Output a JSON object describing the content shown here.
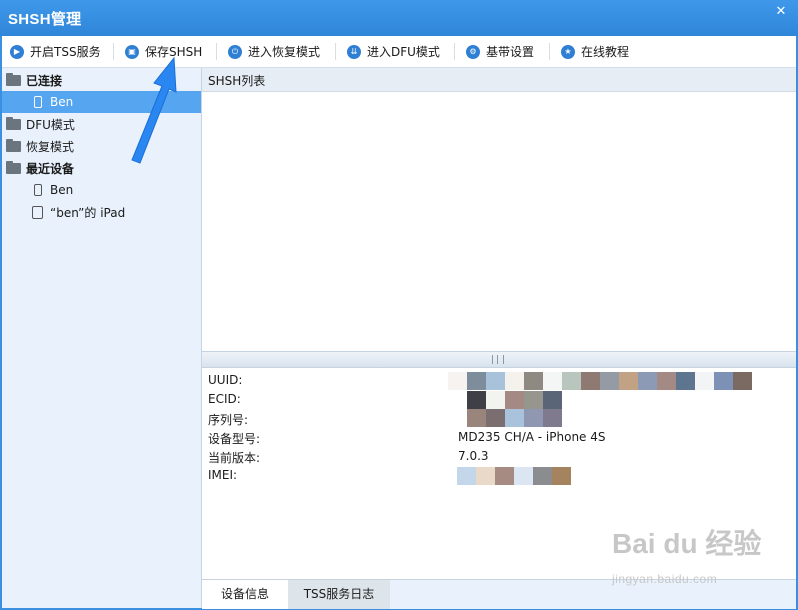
{
  "window": {
    "title": "SHSH管理"
  },
  "toolbar": {
    "buttons": [
      {
        "label": "开启TSS服务",
        "icon": "play-icon"
      },
      {
        "label": "保存SHSH",
        "icon": "save-icon"
      },
      {
        "label": "进入恢复模式",
        "icon": "power-icon"
      },
      {
        "label": "进入DFU模式",
        "icon": "down-arrows-icon"
      },
      {
        "label": "基带设置",
        "icon": "gear-icon"
      },
      {
        "label": "在线教程",
        "icon": "star-icon"
      }
    ]
  },
  "sidebar": {
    "connected": "已连接",
    "connected_device": "Ben",
    "dfu": "DFU模式",
    "recovery": "恢复模式",
    "recent": "最近设备",
    "recent_devices": [
      "Ben",
      "“ben”的 iPad"
    ]
  },
  "list": {
    "header": "SHSH列表"
  },
  "info": {
    "uuid_label": "UUID:",
    "ecid_label": "ECID:",
    "serial_label": "序列号:",
    "model_label": "设备型号:",
    "model_value": "MD235 CH/A - iPhone 4S",
    "version_label": "当前版本:",
    "version_value": "7.0.3",
    "imei_label": "IMEI:"
  },
  "tabs": {
    "device_info": "设备信息",
    "tss_log": "TSS服务日志"
  },
  "watermark": {
    "main": "Bai du 经验",
    "sub": "jingyan.baidu.com"
  },
  "colors": {
    "accent": "#3a8fe0",
    "selection": "#55a5f0",
    "arrow": "#2a86f0"
  }
}
